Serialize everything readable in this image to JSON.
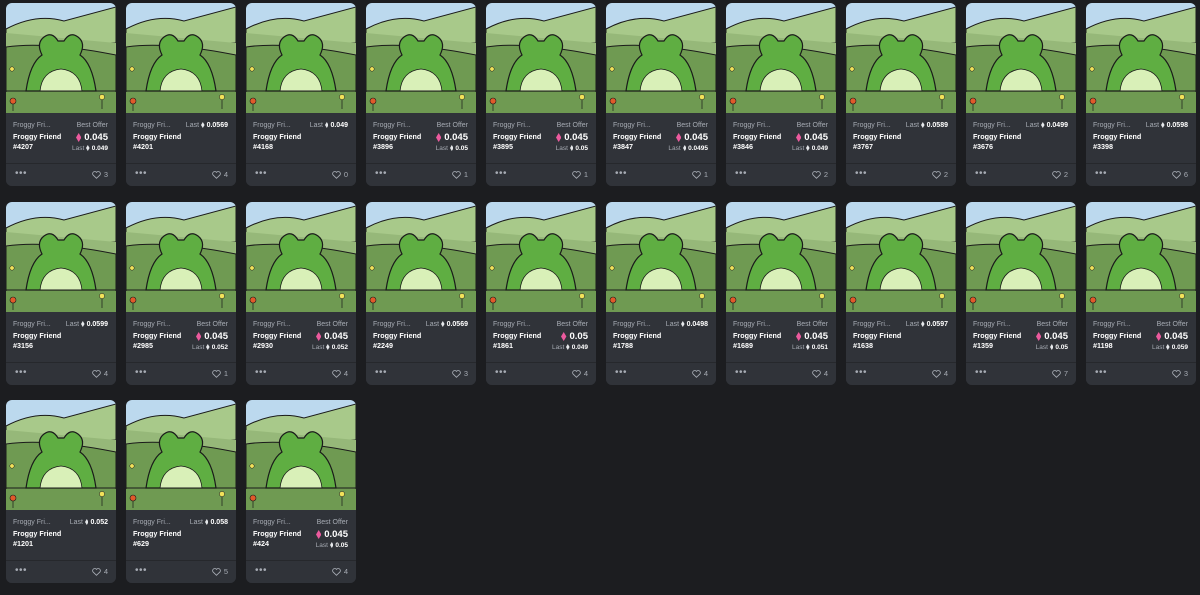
{
  "collection_label": "Froggy Fri...",
  "best_offer_label": "Best Offer",
  "last_label": "Last",
  "more_label": "•••",
  "colors": {
    "accent_eth": "#ec5a9e",
    "background": "#1c1d20",
    "card": "#303339"
  },
  "cards": [
    {
      "title": "Froggy Friend",
      "number": "#4207",
      "mode": "offer",
      "price": "0.045",
      "last": "0.049",
      "likes": "3"
    },
    {
      "title": "Froggy Friend",
      "number": "#4201",
      "mode": "last",
      "last": "0.0569",
      "likes": "4"
    },
    {
      "title": "Froggy Friend",
      "number": "#4168",
      "mode": "last",
      "last": "0.049",
      "likes": "0"
    },
    {
      "title": "Froggy Friend",
      "number": "#3896",
      "mode": "offer",
      "price": "0.045",
      "last": "0.05",
      "likes": "1"
    },
    {
      "title": "Froggy Friend",
      "number": "#3895",
      "mode": "offer",
      "price": "0.045",
      "last": "0.05",
      "likes": "1"
    },
    {
      "title": "Froggy Friend",
      "number": "#3847",
      "mode": "offer",
      "price": "0.045",
      "last": "0.0495",
      "likes": "1"
    },
    {
      "title": "Froggy Friend",
      "number": "#3846",
      "mode": "offer",
      "price": "0.045",
      "last": "0.049",
      "likes": "2"
    },
    {
      "title": "Froggy Friend",
      "number": "#3767",
      "mode": "last",
      "last": "0.0589",
      "likes": "2"
    },
    {
      "title": "Froggy Friend",
      "number": "#3676",
      "mode": "last",
      "last": "0.0499",
      "likes": "2"
    },
    {
      "title": "Froggy Friend",
      "number": "#3398",
      "mode": "last",
      "last": "0.0598",
      "likes": "6"
    },
    {
      "title": "Froggy Friend",
      "number": "#3156",
      "mode": "last",
      "last": "0.0599",
      "likes": "4"
    },
    {
      "title": "Froggy Friend",
      "number": "#2985",
      "mode": "offer",
      "price": "0.045",
      "last": "0.052",
      "likes": "1"
    },
    {
      "title": "Froggy Friend",
      "number": "#2930",
      "mode": "offer",
      "price": "0.045",
      "last": "0.052",
      "likes": "4"
    },
    {
      "title": "Froggy Friend",
      "number": "#2249",
      "mode": "last",
      "last": "0.0569",
      "likes": "3"
    },
    {
      "title": "Froggy Friend",
      "number": "#1861",
      "mode": "offer",
      "price": "0.05",
      "last": "0.049",
      "likes": "4"
    },
    {
      "title": "Froggy Friend",
      "number": "#1788",
      "mode": "last",
      "last": "0.0498",
      "likes": "4"
    },
    {
      "title": "Froggy Friend",
      "number": "#1689",
      "mode": "offer",
      "price": "0.045",
      "last": "0.051",
      "likes": "4"
    },
    {
      "title": "Froggy Friend",
      "number": "#1638",
      "mode": "last",
      "last": "0.0597",
      "likes": "4"
    },
    {
      "title": "Froggy Friend",
      "number": "#1359",
      "mode": "offer",
      "price": "0.045",
      "last": "0.05",
      "likes": "7"
    },
    {
      "title": "Froggy Friend",
      "number": "#1198",
      "mode": "offer",
      "price": "0.045",
      "last": "0.059",
      "likes": "3"
    },
    {
      "title": "Froggy Friend",
      "number": "#1201",
      "mode": "last",
      "last": "0.052",
      "likes": "4"
    },
    {
      "title": "Froggy Friend",
      "number": "#629",
      "mode": "last",
      "last": "0.058",
      "likes": "5"
    },
    {
      "title": "Froggy Friend",
      "number": "#424",
      "mode": "offer",
      "price": "0.045",
      "last": "0.05",
      "likes": "4"
    }
  ]
}
